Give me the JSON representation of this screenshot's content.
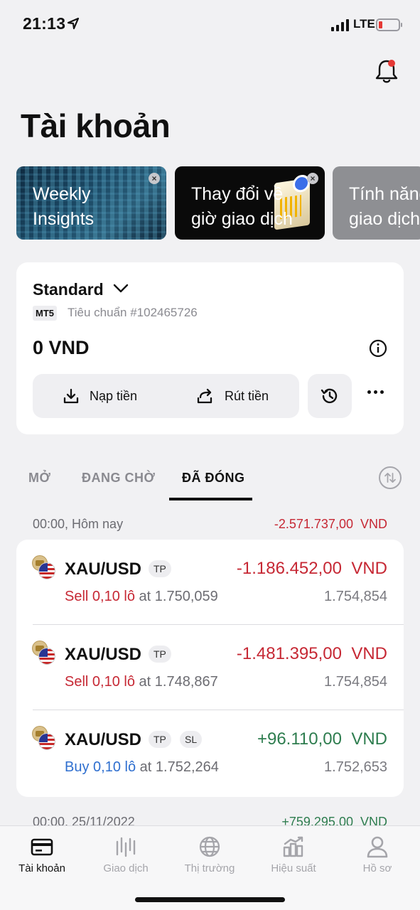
{
  "status_bar": {
    "time": "21:13",
    "network": "LTE"
  },
  "page_title": "Tài khoản",
  "banners": [
    {
      "title": "Weekly Insights"
    },
    {
      "title": "Thay đổi về giờ giao dịch"
    },
    {
      "title": "Tính năng giao dịch"
    }
  ],
  "account": {
    "name": "Standard",
    "platform": "MT5",
    "type_label": "Tiêu chuẩn #102465726",
    "balance": "0 VND",
    "deposit_label": "Nạp tiền",
    "withdraw_label": "Rút tiền"
  },
  "tabs": {
    "open": "MỞ",
    "pending": "ĐANG CHỜ",
    "closed": "ĐÃ ĐÓNG"
  },
  "day_groups": [
    {
      "date": "00:00, Hôm nay",
      "total": "-2.571.737,00",
      "currency": "VND"
    },
    {
      "date": "00:00, 25/11/2022",
      "total": "+759.295,00",
      "currency": "VND"
    }
  ],
  "trades": [
    {
      "symbol": "XAU/USD",
      "tags": [
        "TP"
      ],
      "pnl": "-1.186.452,00",
      "currency": "VND",
      "side": "Sell",
      "lots": "0,10 lô",
      "at": "at",
      "open_price": "1.750,059",
      "close_price": "1.754,854"
    },
    {
      "symbol": "XAU/USD",
      "tags": [
        "TP"
      ],
      "pnl": "-1.481.395,00",
      "currency": "VND",
      "side": "Sell",
      "lots": "0,10 lô",
      "at": "at",
      "open_price": "1.748,867",
      "close_price": "1.754,854"
    },
    {
      "symbol": "XAU/USD",
      "tags": [
        "TP",
        "SL"
      ],
      "pnl": "+96.110,00",
      "currency": "VND",
      "side": "Buy",
      "lots": "0,10 lô",
      "at": "at",
      "open_price": "1.752,264",
      "close_price": "1.752,653"
    }
  ],
  "bottom_nav": [
    {
      "label": "Tài khoản",
      "icon": "card-icon"
    },
    {
      "label": "Giao dịch",
      "icon": "candlestick-icon"
    },
    {
      "label": "Thị trường",
      "icon": "globe-icon"
    },
    {
      "label": "Hiệu suất",
      "icon": "bar-chart-icon"
    },
    {
      "label": "Hồ sơ",
      "icon": "user-icon"
    }
  ],
  "colors": {
    "loss": "#c62834",
    "profit": "#2e7d4f",
    "buy": "#2f6fcf",
    "background": "#f1f1f3"
  }
}
